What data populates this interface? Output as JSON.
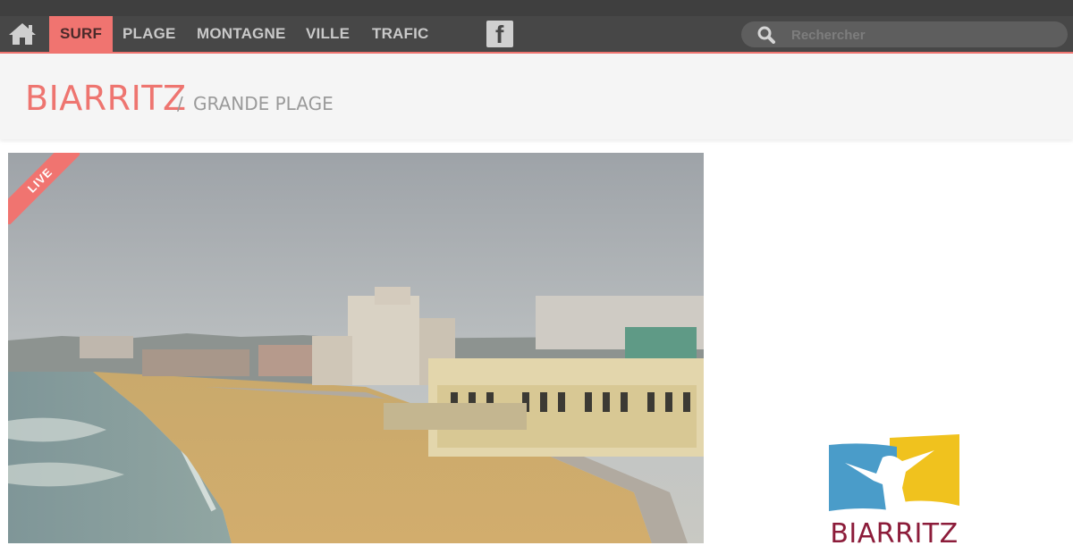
{
  "nav": {
    "home_icon": "home-icon",
    "items": [
      {
        "label": "SURF",
        "active": true
      },
      {
        "label": "PLAGE",
        "active": false
      },
      {
        "label": "MONTAGNE",
        "active": false
      },
      {
        "label": "VILLE",
        "active": false
      },
      {
        "label": "TRAFIC",
        "active": false
      }
    ],
    "social_icon": "facebook-icon",
    "search": {
      "placeholder": "Rechercher",
      "icon": "search-icon"
    }
  },
  "header": {
    "city": "BIARRITZ",
    "separator": "/",
    "spot": "GRANDE PLAGE"
  },
  "webcam": {
    "badge": "LIVE"
  },
  "sponsor": {
    "name": "BIARRITZ"
  },
  "colors": {
    "accent": "#f07470",
    "nav_bg": "#474747",
    "logo_blue": "#4a9cc9",
    "logo_yellow": "#f0c21e",
    "logo_text": "#8c1c3a"
  }
}
